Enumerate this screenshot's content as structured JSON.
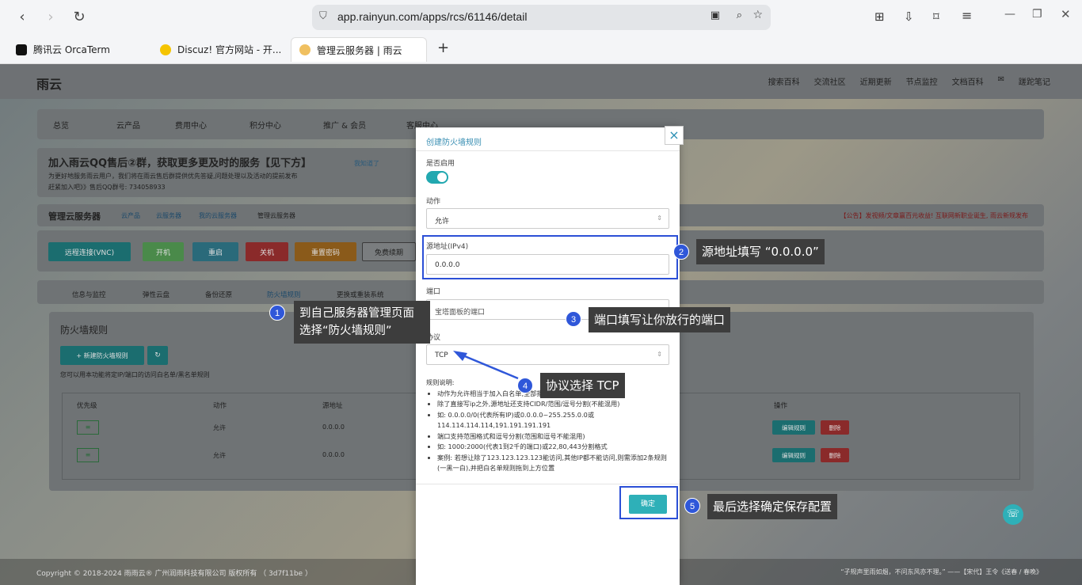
{
  "browser": {
    "url": "app.rainyun.com/apps/rcs/61146/detail",
    "tabs": [
      {
        "label": "腾讯云 OrcaTerm"
      },
      {
        "label": "Discuz! 官方网站 - 开..."
      },
      {
        "label": "管理云服务器 | 雨云"
      }
    ]
  },
  "header": {
    "logo": "雨云",
    "links": [
      "搜索百科",
      "交流社区",
      "近期更新",
      "节点监控",
      "文档百科"
    ],
    "user": "蹉跎笔记"
  },
  "menu": [
    "总览",
    "云产品",
    "费用中心",
    "积分中心",
    "推广 & 会员",
    "客服中心"
  ],
  "banner": {
    "title": "加入雨云QQ售后②群，获取更多更及时的服务【见下方】",
    "dismiss": "我知道了",
    "text1": "为更好地服务雨云用户，我们将在雨云售后群提供优先答疑,问题处理以及活动的提前发布",
    "text2": "赶紧加入吧》》售后QQ群号: 734058933"
  },
  "breadcrumb": {
    "title": "管理云服务器",
    "path": [
      "云产品",
      "云服务器",
      "我的云服务器",
      "管理云服务器"
    ],
    "notice": "【公告】发视频/文章赢百元收益! 互联网新职业诞生, 雨云新规发布"
  },
  "actions": [
    "远程连接(VNC)",
    "开机",
    "重启",
    "关机",
    "重置密码",
    "免费续期"
  ],
  "subtabs": [
    "信息与监控",
    "弹性云盘",
    "备份还原",
    "防火墙规则",
    "更换或重装系统"
  ],
  "firewall": {
    "title": "防火墙规则",
    "new_button": "+ 新建防火墙规则",
    "desc": "您可以用本功能将定IP/端口的访问白名单/黑名单规则",
    "columns": [
      "优先级",
      "动作",
      "源地址",
      "操作"
    ],
    "rows": [
      {
        "action": "允许",
        "src": "0.0.0.0",
        "edit": "编辑规则",
        "delete": "删除"
      },
      {
        "action": "允许",
        "src": "0.0.0.0",
        "edit": "编辑规则",
        "delete": "删除"
      }
    ]
  },
  "modal": {
    "title": "创建防火墙规则",
    "enabled_label": "是否启用",
    "action_label": "动作",
    "action_value": "允许",
    "src_label": "源地址(IPv4)",
    "src_value": "0.0.0.0",
    "port_label": "端口",
    "port_placeholder": "宝塔面板的端口",
    "protocol_label": "协议",
    "protocol_value": "TCP",
    "notes_title": "规则说明:",
    "notes": [
      "动作为允许相当于加入白名单,全部拒绝为黑名单",
      "除了直接写ip之外,源地址还支持CIDR/范围/逗号分割(不能混用)",
      "如: 0.0.0.0/0(代表所有IP)或0.0.0.0~255.255.0.0或114.114.114.114,191.191.191.191",
      "端口支持范围格式和逗号分割(范围和逗号不能混用)",
      "如: 1000:2000(代表1到2千的端口)或22,80,443分割格式",
      "案例: 若想让除了123.123.123.123能访问,其他IP都不能访问,则需添加2条规则(一黑一白),并把白名单规则拖到上方位置"
    ],
    "ok": "确定",
    "close": "×"
  },
  "annotations": [
    {
      "n": "1",
      "text1": "到自己服务器管理页面",
      "text2": "选择“防火墙规则”"
    },
    {
      "n": "2",
      "text": "源地址填写 “0.0.0.0”"
    },
    {
      "n": "3",
      "text": "端口填写让你放行的端口"
    },
    {
      "n": "4",
      "text": "协议选择 TCP"
    },
    {
      "n": "5",
      "text": "最后选择确定保存配置"
    }
  ],
  "footer": {
    "left": "Copyright © 2018-2024 雨雨云® 广州润雨科技有限公司 版权所有 （ 3d7f11be ）",
    "right": "“子规声里雨如烟，不问东风亦不理。” ——【宋代】王令《送春 / 春晚》"
  },
  "colors": {
    "accent": "#22a8b0",
    "annotation": "#2f57d9",
    "danger": "#d94f4f"
  }
}
